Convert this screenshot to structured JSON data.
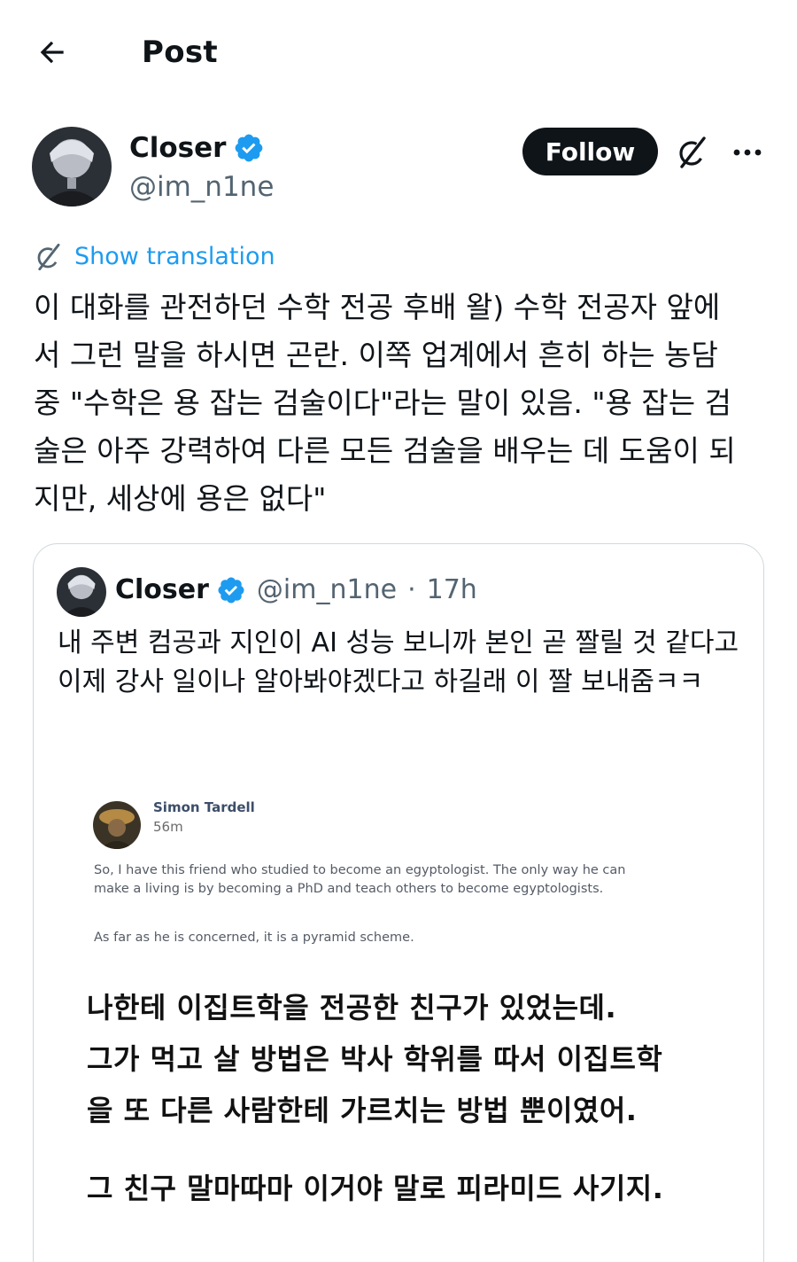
{
  "header": {
    "title": "Post"
  },
  "author": {
    "name": "Closer",
    "handle": "@im_n1ne",
    "verified": true
  },
  "actions": {
    "follow_label": "Follow"
  },
  "translation": {
    "label": "Show translation"
  },
  "post": {
    "text": "이 대화를 관전하던 수학 전공 후배 왈) 수학 전공자 앞에\n서 그런 말을 하시면 곤란. 이쪽 업계에서 흔히 하는 농담\n중 \"수학은 용 잡는 검술이다\"라는 말이 있음. \"용 잡는 검\n술은 아주 강력하여 다른 모든 검술을 배우는 데 도움이 되\n지만, 세상에 용은 없다\""
  },
  "quote": {
    "name": "Closer",
    "handle": "@im_n1ne",
    "separator": "·",
    "time": "17h",
    "text": "내 주변 컴공과 지인이 AI 성능 보니까 본인 곧 짤릴 것 같다고\n이제 강사 일이나 알아봐야겠다고 하길래 이 짤 보내줌ㅋㅋ",
    "media": {
      "author": "Simon Tardell",
      "time": "56m",
      "body_1": "So, I have this friend who studied to become an egyptologist. The only way he can make a living is by becoming a PhD and teach others to become egyptologists.",
      "body_2": "As far as he is concerned, it is a pyramid scheme.",
      "caption_1": "나한테 이집트학을 전공한 친구가 있었는데.\n그가 먹고 살 방법은 박사 학위를 따서 이집트학\n을 또 다른 사람한테 가르치는 방법 뿐이였어.",
      "caption_2": "그 친구 말마따마 이거야 말로 피라미드 사기지."
    }
  },
  "colors": {
    "accent": "#1d9bf0",
    "text": "#0f1419",
    "secondary": "#536471",
    "border": "#cfd9de"
  }
}
